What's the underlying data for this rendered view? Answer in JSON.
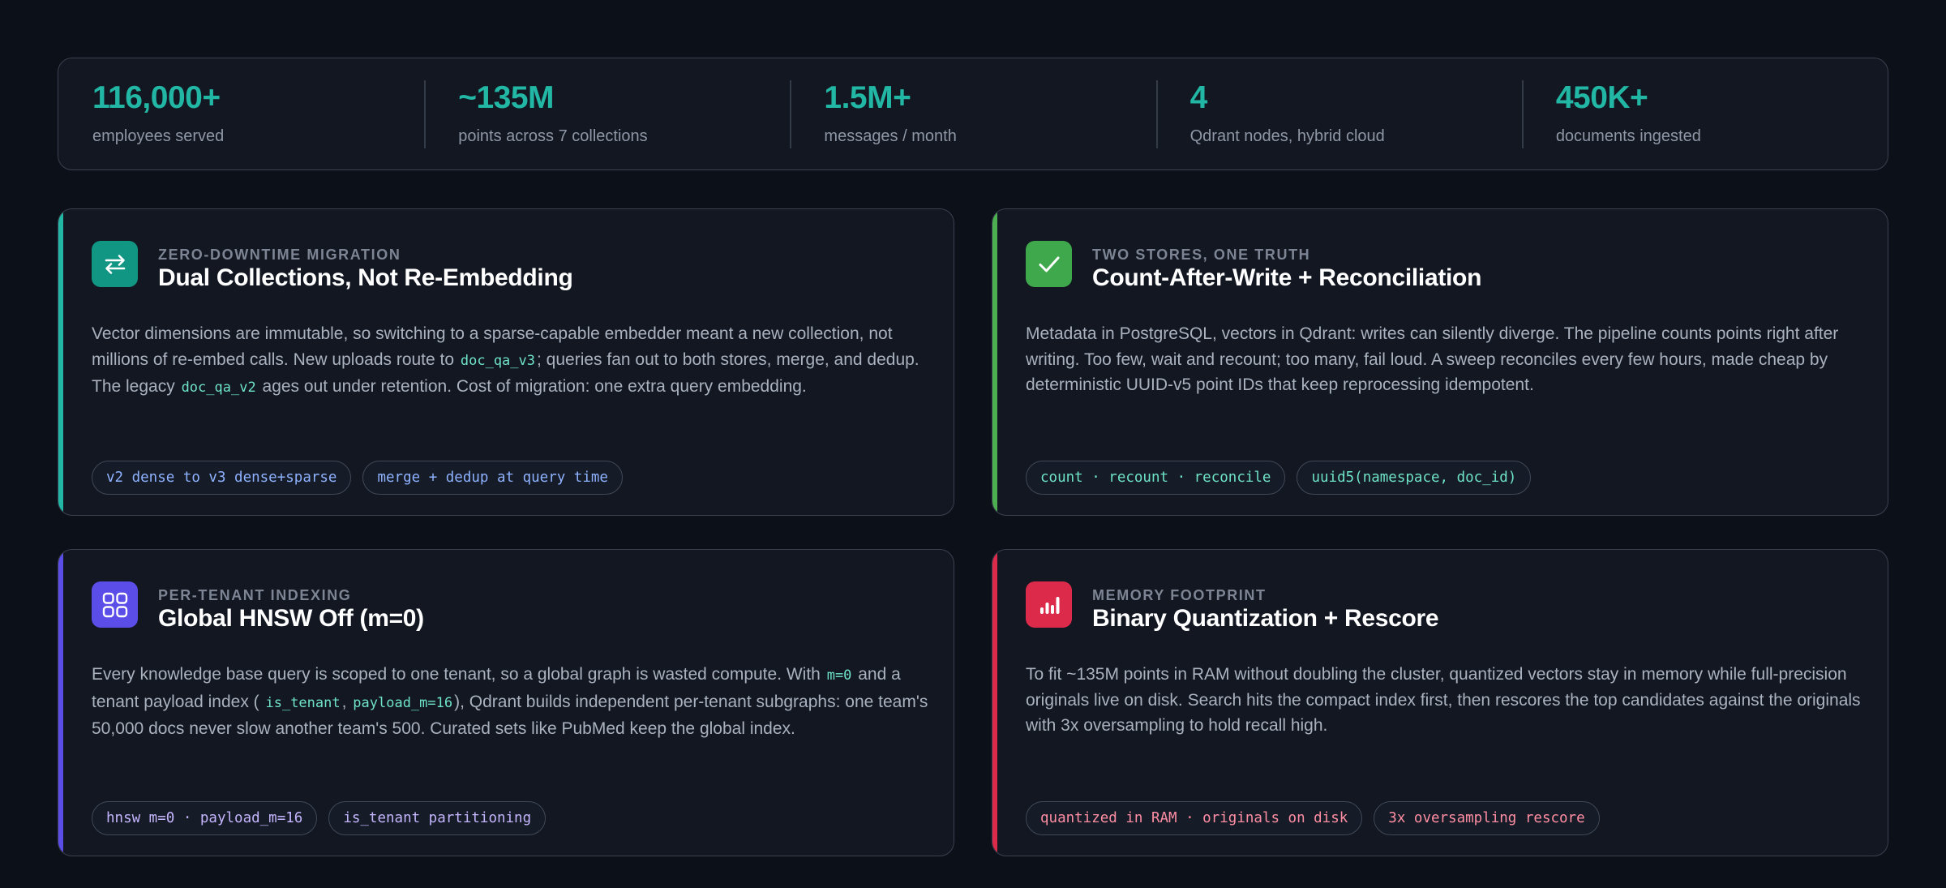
{
  "stats": [
    {
      "value": "116,000+",
      "label": "employees served"
    },
    {
      "value": "~135M",
      "label": "points across 7 collections"
    },
    {
      "value": "1.5M+",
      "label": "messages / month"
    },
    {
      "value": "4",
      "label": "Qdrant nodes, hybrid cloud"
    },
    {
      "value": "450K+",
      "label": "documents ingested"
    }
  ],
  "colors": {
    "stat_value": "#22b7a4",
    "teal_accent": "#22b7a4",
    "green_accent": "#4caf50",
    "violet_accent": "#5b4de8",
    "red_accent": "#dc2a4a"
  },
  "cards": [
    {
      "icon": "swap-arrows-icon",
      "eyebrow": "ZERO-DOWNTIME MIGRATION",
      "title": "Dual Collections, Not Re-Embedding",
      "body": [
        "Vector dimensions are immutable, so switching to a sparse-capable embedder meant a new collection, not millions of re-embed calls. New uploads route to ",
        "doc_qa_v3",
        "; queries fan out to both stores, merge, and dedup. The legacy ",
        "doc_qa_v2",
        " ages out under retention. Cost of migration: one extra query embedding."
      ],
      "tags": [
        "v2 dense to v3 dense+sparse",
        "merge + dedup at query time"
      ]
    },
    {
      "icon": "checkmark-icon",
      "eyebrow": "TWO STORES, ONE TRUTH",
      "title": "Count-After-Write + Reconciliation",
      "body": [
        "Metadata in PostgreSQL, vectors in Qdrant: writes can silently diverge. The pipeline counts points right after writing. Too few, wait and recount; too many, fail loud. A sweep reconciles every few hours, made cheap by deterministic UUID-v5 point IDs that keep reprocessing idempotent."
      ],
      "tags": [
        "count · recount · reconcile",
        "uuid5(namespace, doc_id)"
      ]
    },
    {
      "icon": "grid-icon",
      "eyebrow": "PER-TENANT INDEXING",
      "title": "Global HNSW Off (m=0)",
      "body": [
        "Every knowledge base query is scoped to one tenant, so a global graph is wasted compute. With ",
        "m=0",
        " and a tenant payload index ( ",
        "is_tenant",
        ", ",
        "payload_m=16",
        "), Qdrant builds independent per-tenant subgraphs: one team's 50,000 docs never slow another team's 500. Curated sets like PubMed keep the global index."
      ],
      "tags": [
        "hnsw m=0 · payload_m=16",
        "is_tenant partitioning"
      ]
    },
    {
      "icon": "bar-chart-icon",
      "eyebrow": "MEMORY FOOTPRINT",
      "title": "Binary Quantization + Rescore",
      "body": [
        "To fit ~135M points in RAM without doubling the cluster, quantized vectors stay in memory while full-precision originals live on disk. Search hits the compact index first, then rescores the top candidates against the originals with 3x oversampling to hold recall high."
      ],
      "tags": [
        "quantized in RAM · originals on disk",
        "3x oversampling rescore"
      ]
    }
  ]
}
